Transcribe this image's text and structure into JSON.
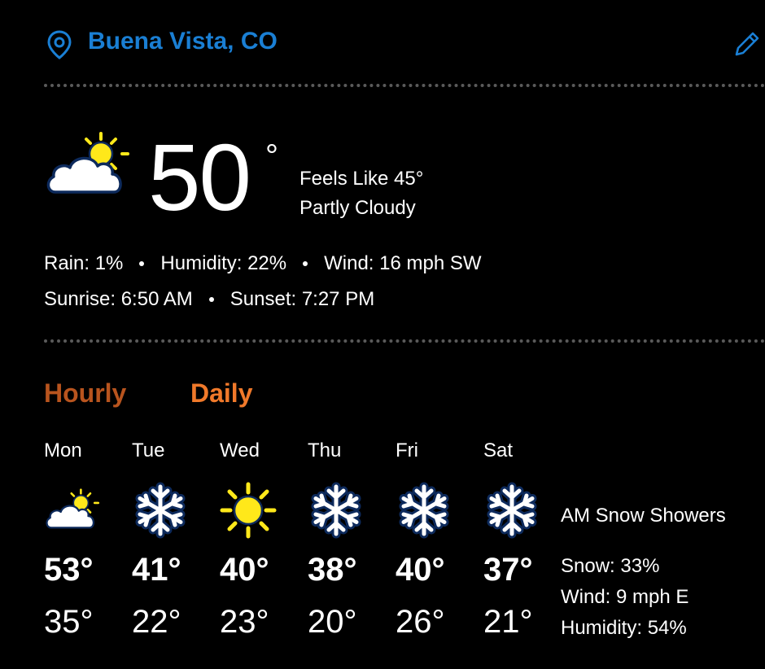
{
  "location": {
    "name": "Buena Vista, CO",
    "pin_icon": "location-pin-icon",
    "edit_icon": "pencil-icon"
  },
  "current": {
    "icon": "partly-cloudy-icon",
    "temp": "50",
    "degree": "°",
    "feels_like": "Feels Like 45°",
    "condition": "Partly Cloudy",
    "rain": "Rain: 1%",
    "humidity": "Humidity: 22%",
    "wind": "Wind: 16 mph SW",
    "sunrise": "Sunrise: 6:50 AM",
    "sunset": "Sunset: 7:27 PM"
  },
  "tabs": {
    "hourly": "Hourly",
    "daily": "Daily",
    "selected": "daily"
  },
  "daily": [
    {
      "day": "Mon",
      "icon": "partly-cloudy-icon",
      "hi": "53°",
      "lo": "35°"
    },
    {
      "day": "Tue",
      "icon": "snowflake-icon",
      "hi": "41°",
      "lo": "22°"
    },
    {
      "day": "Wed",
      "icon": "sun-icon",
      "hi": "40°",
      "lo": "23°"
    },
    {
      "day": "Thu",
      "icon": "snowflake-icon",
      "hi": "38°",
      "lo": "20°"
    },
    {
      "day": "Fri",
      "icon": "snowflake-icon",
      "hi": "40°",
      "lo": "26°"
    },
    {
      "day": "Sat",
      "icon": "snowflake-icon",
      "hi": "37°",
      "lo": "21°"
    }
  ],
  "day_detail": {
    "summary": "AM Snow Showers",
    "snow": "Snow: 33%",
    "wind": "Wind: 9 mph E",
    "humidity": "Humidity: 54%"
  },
  "colors": {
    "background": "#000000",
    "location_blue": "#1a7fd4",
    "hourly_tab": "#b8541e",
    "daily_tab": "#f0792a",
    "sun_yellow": "#ffe81a",
    "icon_navy": "#0d2a5c"
  }
}
